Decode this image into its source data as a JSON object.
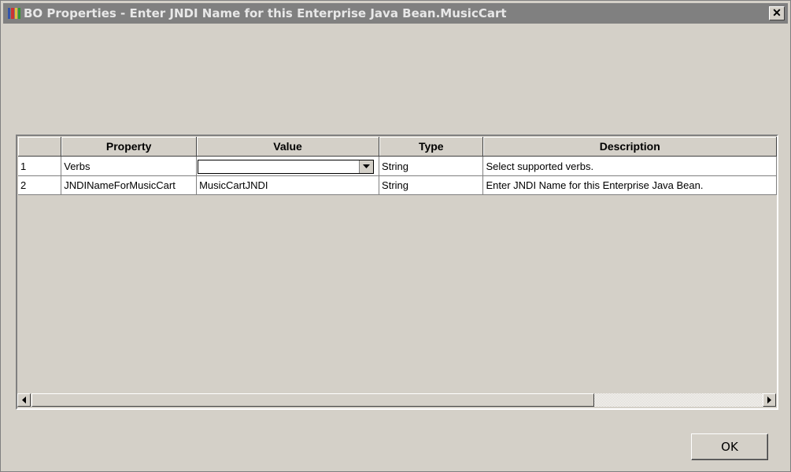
{
  "window": {
    "title": "BO Properties - Enter JNDI Name for this Enterprise Java Bean.MusicCart",
    "close_label": "✕"
  },
  "grid": {
    "columns": [
      "",
      "Property",
      "Value",
      "Type",
      "Description"
    ],
    "rows": [
      {
        "num": "1",
        "property": "Verbs",
        "value": "",
        "type": "String",
        "description": "Select supported verbs."
      },
      {
        "num": "2",
        "property": "JNDINameForMusicCart",
        "value": "MusicCartJNDI",
        "type": "String",
        "description": "Enter JNDI Name for this Enterprise Java Bean."
      }
    ]
  },
  "buttons": {
    "ok_label": "OK"
  },
  "icons": {
    "app_icon": "app-icon",
    "close": "close-icon",
    "dropdown": "chevron-down-icon",
    "scroll_left": "arrow-left-icon",
    "scroll_right": "arrow-right-icon"
  },
  "colors": {
    "titlebar_inactive": "#808080",
    "dialog_bg": "#d4d0c8",
    "cell_bg": "#ffffff"
  }
}
